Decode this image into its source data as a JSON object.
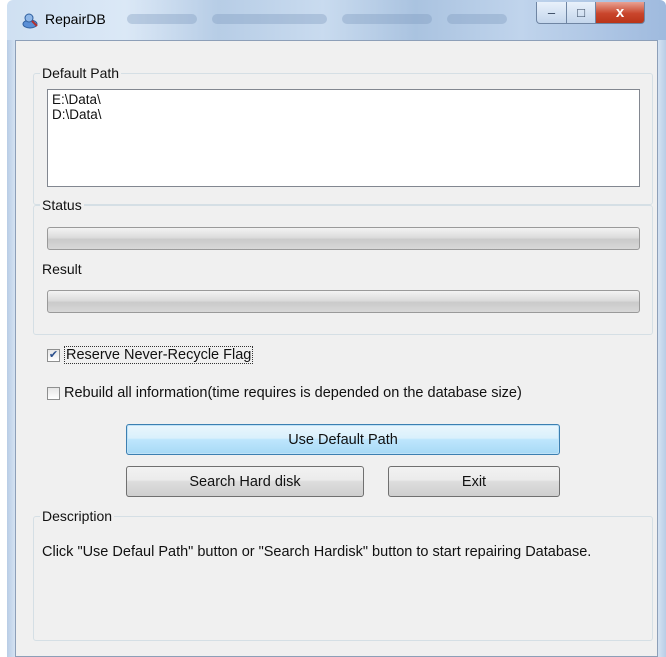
{
  "window": {
    "title": "RepairDB",
    "minimize_glyph": "–",
    "maximize_glyph": "□",
    "close_glyph": "x",
    "app_icon": "repair-db-app-icon"
  },
  "default_path": {
    "label": "Default Path",
    "items": [
      "E:\\Data\\",
      "D:\\Data\\"
    ]
  },
  "status": {
    "label": "Status",
    "progress": 0
  },
  "result": {
    "label": "Result",
    "progress": 0
  },
  "options": {
    "reserve_flag": {
      "label": "Reserve Never-Recycle Flag",
      "checked": true,
      "check_glyph": "✔"
    },
    "rebuild_all": {
      "label": "Rebuild all information(time requires is depended on the database size)",
      "checked": false
    }
  },
  "buttons": {
    "use_default_path": "Use Default Path",
    "search_hard_disk": "Search Hard disk",
    "exit": "Exit"
  },
  "description": {
    "label": "Description",
    "text": "Click \"Use Defaul Path\" button or \"Search Hardisk\" button to start repairing Database."
  },
  "colors": {
    "accent": "#3c7fb1",
    "close_button": "#c9452c",
    "titlebar": "#c9dbef"
  }
}
